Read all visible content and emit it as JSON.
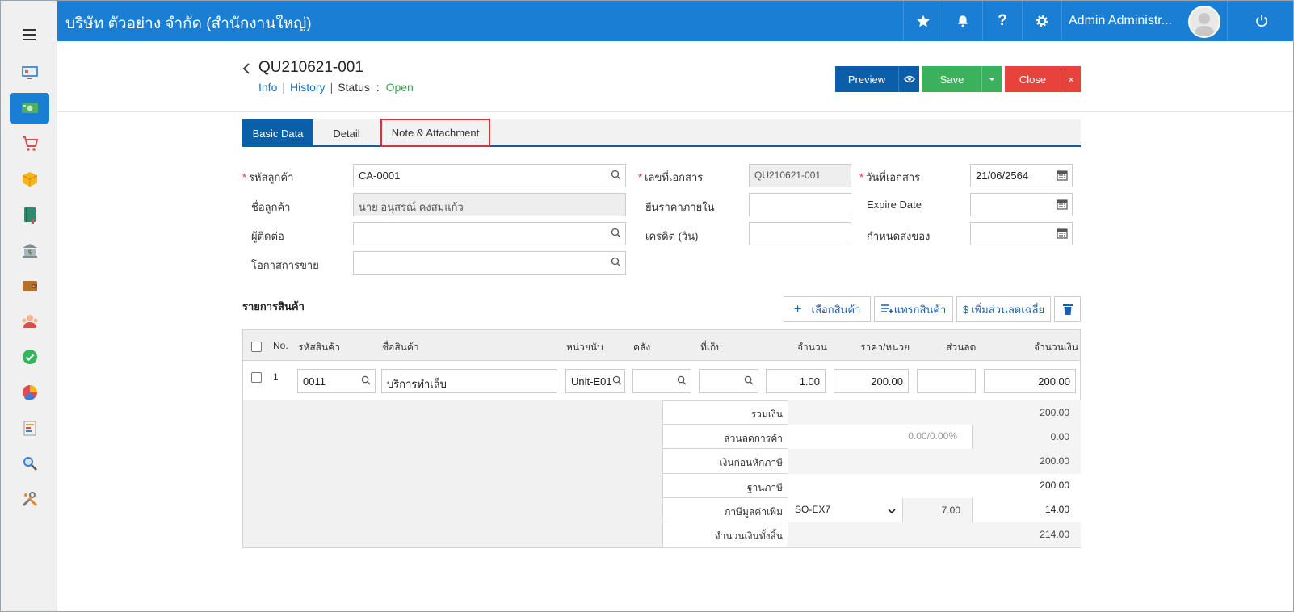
{
  "topbar": {
    "company": "บริษัท ตัวอย่าง จำกัด (สำนักงานใหญ่)",
    "username": "Admin Administr...",
    "icons": [
      "star-icon",
      "bell-icon",
      "help-icon",
      "gear-icon",
      "power-icon"
    ]
  },
  "sidebar": {
    "items": [
      "dashboard-icon",
      "money-icon",
      "cart-icon",
      "box-icon",
      "book-icon",
      "bank-icon",
      "wallet-icon",
      "people-icon",
      "check-icon",
      "pie-chart-icon",
      "report-icon",
      "search-report-icon",
      "tools-icon"
    ],
    "active_index": 1
  },
  "document": {
    "number": "QU210621-001",
    "link_info": "Info",
    "link_history": "History",
    "status_label": "Status",
    "status_sep": ":",
    "status_value": "Open"
  },
  "actions": {
    "preview": "Preview",
    "save": "Save",
    "close": "Close",
    "close_x": "×"
  },
  "tabs": [
    "Basic Data",
    "Detail",
    "Note & Attachment"
  ],
  "form": {
    "customer_code_label": "รหัสลูกค้า",
    "customer_code": "CA-0001",
    "customer_name_label": "ชื่อลูกค้า",
    "customer_name": "นาย อนุสรณ์ คงสมแก้ว",
    "contact_label": "ผู้ติดต่อ",
    "contact": "",
    "opportunity_label": "โอกาสการขาย",
    "opportunity": "",
    "doc_no_label": "เลขที่เอกสาร",
    "doc_no": "QU210621-001",
    "price_hold_label": "ยืนราคาภายใน",
    "price_hold": "",
    "credit_label": "เครดิต (วัน)",
    "credit": "",
    "doc_date_label": "วันที่เอกสาร",
    "doc_date": "21/06/2564",
    "expire_label": "Expire Date",
    "expire": "",
    "delivery_label": "กำหนดส่งของ",
    "delivery": ""
  },
  "items_section": {
    "title": "รายการสินค้า",
    "btn_select": "เลือกสินค้า",
    "btn_insert": "แทรกสินค้า",
    "btn_discount": "เพิ่มส่วนลดเฉลี่ย"
  },
  "table": {
    "headers": {
      "no": "No.",
      "code": "รหัสสินค้า",
      "name": "ชื่อสินค้า",
      "unit": "หน่วยนับ",
      "warehouse": "คลัง",
      "location": "ที่เก็บ",
      "qty": "จำนวน",
      "price": "ราคา/หน่วย",
      "discount": "ส่วนลด",
      "amount": "จำนวนเงิน"
    },
    "rows": [
      {
        "no": "1",
        "code": "0011",
        "name": "บริการทำเล็บ",
        "unit": "Unit-E01",
        "warehouse": "",
        "location": "",
        "qty": "1.00",
        "price": "200.00",
        "discount": "",
        "amount": "200.00"
      }
    ]
  },
  "summary": {
    "subtotal_label": "รวมเงิน",
    "subtotal": "200.00",
    "trade_discount_label": "ส่วนลดการค้า",
    "trade_discount_placeholder": "0.00/0.00%",
    "trade_discount": "0.00",
    "before_tax_label": "เงินก่อนหักภาษี",
    "before_tax": "200.00",
    "tax_base_label": "ฐานภาษี",
    "tax_base": "200.00",
    "vat_label": "ภาษีมูลค่าเพิ่ม",
    "vat_code": "SO-EX7",
    "vat_rate": "7.00",
    "vat_amount": "14.00",
    "grand_total_label": "จำนวนเงินทั้งสิ้น",
    "grand_total": "214.00"
  },
  "colors": {
    "primary": "#1a7fd4",
    "dark_blue": "#0b5ea8",
    "save": "#3bb15b",
    "close": "#e8423d",
    "status_open": "#3aa655"
  }
}
